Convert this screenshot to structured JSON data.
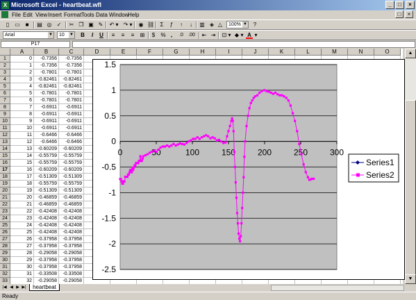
{
  "window": {
    "title": "Microsoft Excel - heartbeat.wfl",
    "logo": "X"
  },
  "menu": [
    "File",
    "Edit",
    "View",
    "Insert",
    "Format",
    "Tools",
    "Data",
    "Window",
    "Help"
  ],
  "toolbar": {
    "zoom": "100%"
  },
  "format_toolbar": {
    "font": "Arial",
    "size": "10",
    "bold": "B",
    "italic": "I",
    "underline": "U",
    "currency": "$",
    "percent": "%",
    "comma": ",",
    "dec_inc": ".0",
    "dec_dec": ".00"
  },
  "formula_bar": {
    "name_box": "P17",
    "formula": ""
  },
  "columns": [
    "A",
    "B",
    "C",
    "D",
    "E",
    "F",
    "G",
    "H",
    "I",
    "J",
    "K",
    "L",
    "M",
    "N",
    "O"
  ],
  "rows": [
    [
      "0",
      "-0.7356",
      "-0.7356"
    ],
    [
      "1",
      "-0.7356",
      "-0.7356"
    ],
    [
      "2",
      "-0.7801",
      "-0.7801"
    ],
    [
      "3",
      "-0.82461",
      "-0.82461"
    ],
    [
      "4",
      "-0.82461",
      "-0.82461"
    ],
    [
      "5",
      "-0.7801",
      "-0.7801"
    ],
    [
      "6",
      "-0.7801",
      "-0.7801"
    ],
    [
      "7",
      "-0.6911",
      "-0.6911"
    ],
    [
      "8",
      "-0.6911",
      "-0.6911"
    ],
    [
      "9",
      "-0.6911",
      "-0.6911"
    ],
    [
      "10",
      "-0.6911",
      "-0.6911"
    ],
    [
      "11",
      "-0.6466",
      "-0.6466"
    ],
    [
      "12",
      "-0.6466",
      "-0.6466"
    ],
    [
      "13",
      "-0.60209",
      "-0.60209"
    ],
    [
      "14",
      "-0.55759",
      "-0.55759"
    ],
    [
      "15",
      "-0.55759",
      "-0.55759"
    ],
    [
      "16",
      "-0.60209",
      "-0.60209"
    ],
    [
      "17",
      "-0.51309",
      "-0.51309"
    ],
    [
      "18",
      "-0.55759",
      "-0.55759"
    ],
    [
      "19",
      "-0.51309",
      "-0.51309"
    ],
    [
      "20",
      "-0.46859",
      "-0.46859"
    ],
    [
      "21",
      "-0.46859",
      "-0.46859"
    ],
    [
      "22",
      "-0.42408",
      "-0.42408"
    ],
    [
      "23",
      "-0.42408",
      "-0.42408"
    ],
    [
      "24",
      "-0.42408",
      "-0.42408"
    ],
    [
      "25",
      "-0.42408",
      "-0.42408"
    ],
    [
      "26",
      "-0.37958",
      "-0.37958"
    ],
    [
      "27",
      "-0.37958",
      "-0.37958"
    ],
    [
      "28",
      "-0.29058",
      "-0.29058"
    ],
    [
      "29",
      "-0.37958",
      "-0.37958"
    ],
    [
      "30",
      "-0.37958",
      "-0.37958"
    ],
    [
      "31",
      "-0.33508",
      "-0.33508"
    ],
    [
      "32",
      "-0.29058",
      "-0.29058"
    ]
  ],
  "sheet_tabs": [
    "heartbeat"
  ],
  "status": "Ready",
  "chart_data": {
    "type": "line",
    "xlim": [
      0,
      300
    ],
    "ylim": [
      -2.5,
      1.5
    ],
    "x_ticks": [
      "0",
      "50",
      "100",
      "150",
      "200",
      "250",
      "300"
    ],
    "y_ticks": [
      "1.5",
      "1",
      "0.5",
      "0",
      "-0.5",
      "-1",
      "-1.5",
      "-2",
      "-2.5"
    ],
    "plot_area_color": "#c0c0c0",
    "grid": true,
    "legend_position": "right",
    "series": [
      {
        "name": "Series1",
        "color": "#000080",
        "marker": "diamond"
      },
      {
        "name": "Series2",
        "color": "#ff00ff",
        "marker": "square"
      }
    ],
    "points": [
      [
        0,
        -0.7356
      ],
      [
        1,
        -0.7356
      ],
      [
        2,
        -0.7801
      ],
      [
        3,
        -0.82461
      ],
      [
        4,
        -0.82461
      ],
      [
        5,
        -0.7801
      ],
      [
        6,
        -0.7801
      ],
      [
        7,
        -0.6911
      ],
      [
        8,
        -0.6911
      ],
      [
        9,
        -0.6911
      ],
      [
        10,
        -0.6911
      ],
      [
        11,
        -0.6466
      ],
      [
        12,
        -0.6466
      ],
      [
        13,
        -0.60209
      ],
      [
        14,
        -0.55759
      ],
      [
        15,
        -0.55759
      ],
      [
        16,
        -0.60209
      ],
      [
        17,
        -0.51309
      ],
      [
        18,
        -0.55759
      ],
      [
        19,
        -0.51309
      ],
      [
        20,
        -0.46859
      ],
      [
        21,
        -0.46859
      ],
      [
        22,
        -0.42408
      ],
      [
        23,
        -0.42408
      ],
      [
        24,
        -0.42408
      ],
      [
        25,
        -0.42408
      ],
      [
        26,
        -0.37958
      ],
      [
        27,
        -0.37958
      ],
      [
        28,
        -0.29058
      ],
      [
        29,
        -0.37958
      ],
      [
        30,
        -0.37958
      ],
      [
        31,
        -0.33508
      ],
      [
        32,
        -0.29058
      ],
      [
        35,
        -0.27
      ],
      [
        38,
        -0.25
      ],
      [
        41,
        -0.22
      ],
      [
        44,
        -0.2
      ],
      [
        47,
        -0.18
      ],
      [
        50,
        -0.2
      ],
      [
        53,
        -0.16
      ],
      [
        56,
        -0.12
      ],
      [
        59,
        -0.1
      ],
      [
        62,
        -0.1
      ],
      [
        65,
        -0.08
      ],
      [
        68,
        -0.1
      ],
      [
        71,
        -0.08
      ],
      [
        74,
        -0.05
      ],
      [
        77,
        -0.08
      ],
      [
        80,
        -0.06
      ],
      [
        83,
        -0.04
      ],
      [
        86,
        -0.05
      ],
      [
        89,
        -0.06
      ],
      [
        92,
        -0.03
      ],
      [
        95,
        0.0
      ],
      [
        98,
        0.02
      ],
      [
        101,
        0.05
      ],
      [
        104,
        0.05
      ],
      [
        107,
        0.08
      ],
      [
        110,
        0.05
      ],
      [
        113,
        0.08
      ],
      [
        116,
        0.1
      ],
      [
        119,
        0.12
      ],
      [
        122,
        0.1
      ],
      [
        125,
        0.06
      ],
      [
        128,
        0.08
      ],
      [
        131,
        0.06
      ],
      [
        134,
        0.02
      ],
      [
        137,
        0.03
      ],
      [
        140,
        0.0
      ],
      [
        143,
        -0.03
      ],
      [
        146,
        -0.02
      ],
      [
        148,
        0.1
      ],
      [
        150,
        0.2
      ],
      [
        152,
        0.3
      ],
      [
        154,
        0.4
      ],
      [
        155,
        0.45
      ],
      [
        156,
        0.4
      ],
      [
        157,
        0.2
      ],
      [
        158,
        -0.2
      ],
      [
        159,
        -0.5
      ],
      [
        160,
        -0.8
      ],
      [
        161,
        -1.1
      ],
      [
        162,
        -1.4
      ],
      [
        163,
        -1.6
      ],
      [
        164,
        -1.8
      ],
      [
        165,
        -1.9
      ],
      [
        166,
        -1.95
      ],
      [
        167,
        -1.85
      ],
      [
        168,
        -1.6
      ],
      [
        169,
        -1.3
      ],
      [
        170,
        -1.0
      ],
      [
        171,
        -0.7
      ],
      [
        172,
        -0.3
      ],
      [
        173,
        0.0
      ],
      [
        175,
        0.3
      ],
      [
        177,
        0.5
      ],
      [
        179,
        0.65
      ],
      [
        181,
        0.75
      ],
      [
        183,
        0.8
      ],
      [
        185,
        0.85
      ],
      [
        187,
        0.88
      ],
      [
        190,
        0.9
      ],
      [
        193,
        0.95
      ],
      [
        196,
        0.98
      ],
      [
        200,
        1.0
      ],
      [
        203,
        0.98
      ],
      [
        206,
        0.97
      ],
      [
        209,
        0.95
      ],
      [
        212,
        0.93
      ],
      [
        215,
        0.95
      ],
      [
        218,
        0.92
      ],
      [
        221,
        0.9
      ],
      [
        224,
        0.9
      ],
      [
        227,
        0.88
      ],
      [
        230,
        0.85
      ],
      [
        233,
        0.8
      ],
      [
        236,
        0.7
      ],
      [
        239,
        0.55
      ],
      [
        242,
        0.4
      ],
      [
        245,
        0.2
      ],
      [
        248,
        -0.05
      ],
      [
        251,
        -0.25
      ],
      [
        254,
        -0.45
      ],
      [
        257,
        -0.6
      ],
      [
        260,
        -0.7
      ],
      [
        262,
        -0.75
      ],
      [
        264,
        -0.74
      ],
      [
        266,
        -0.73
      ],
      [
        268,
        -0.73
      ]
    ]
  }
}
